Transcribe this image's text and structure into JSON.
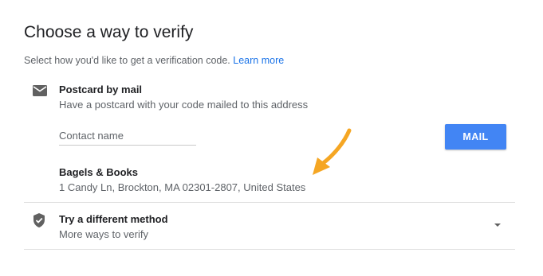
{
  "page": {
    "title": "Choose a way to verify",
    "subtitle": "Select how you'd like to get a verification code.",
    "learn_more": "Learn more"
  },
  "mail_option": {
    "icon": "mail-icon",
    "title": "Postcard by mail",
    "description": "Have a postcard with your code mailed to this address",
    "contact_placeholder": "Contact name",
    "contact_value": "",
    "button_label": "MAIL",
    "business_name": "Bagels & Books",
    "business_address": "1 Candy Ln, Brockton, MA 02301-2807, United States"
  },
  "other_option": {
    "icon": "shield-check-icon",
    "title": "Try a different method",
    "description": "More ways to verify",
    "expand_icon": "chevron-down-icon"
  },
  "colors": {
    "accent": "#4285f4",
    "link": "#1a73e8",
    "annotation_arrow": "#f5a623"
  }
}
